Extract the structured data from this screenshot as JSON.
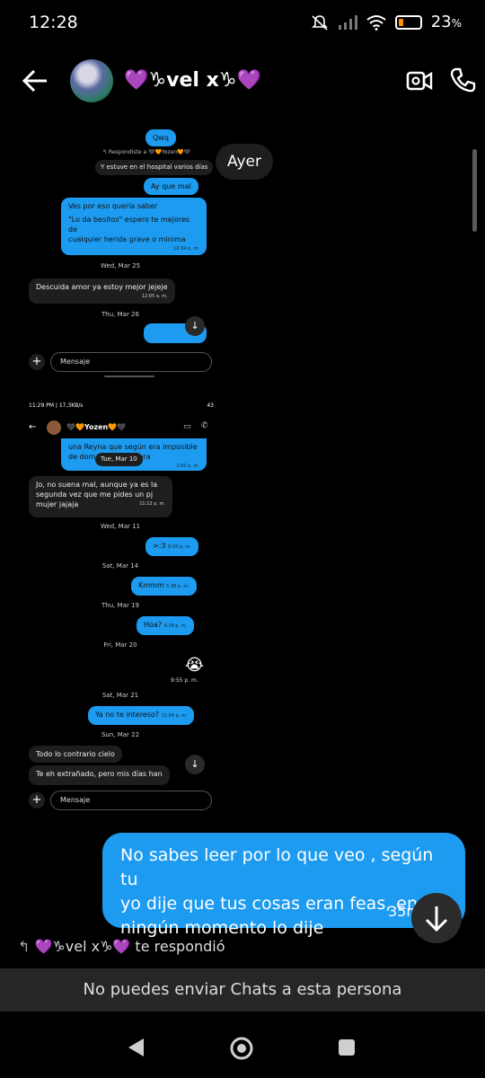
{
  "status": {
    "time": "12:28",
    "battery": "23",
    "battery_unit": "%",
    "battery_level": 0.23,
    "accent": "#ff9100"
  },
  "header": {
    "name": "💜♑vel x♑💜",
    "icons": [
      "back-arrow-icon",
      "video-call-icon",
      "phone-icon"
    ]
  },
  "shot1": {
    "m1": "Qwq",
    "reply_label": "↰ Respondiste a 🖤🧡Yozen🧡🖤",
    "quote": "Y estuve en el hospital varios días",
    "m2": "Ay que mal",
    "m3a": "Ves por eso quería saber",
    "m3b": "\"Lo da besitos\" espero te mejores de",
    "m3c": "cualquier herida grave o minima",
    "m3_time": "10:34 p. m.",
    "day1": "Wed, Mar 25",
    "m4": "Descuida amor ya estoy mejor jejeje",
    "m4_time": "12:05 a. m.",
    "day2": "Thu, Mar 26",
    "composer": "Mensaje"
  },
  "shot2": {
    "status_left": "11:29 PM | 17,3KB/s",
    "status_right": "43",
    "name": "🖤🧡Yozen🧡🖤",
    "top_a": "una Reyna que según era imposible",
    "top_b": "de dom              son mi ternura",
    "top_time": "1:50 p. m.",
    "sticky_day": "Tue, Mar 10",
    "m1a": "Jo, no suena mal, aunque ya es la",
    "m1b": "segunda vez que me pides un pj",
    "m1c": "mujer jajaja",
    "m1_time": "11:12 p. m.",
    "day1": "Wed, Mar 11",
    "m2": ">:3",
    "m2_time": "8:05 p. m.",
    "day2": "Sat, Mar 14",
    "m3": "Kmmm",
    "m3_time": "5:36 p. m.",
    "day3": "Thu, Mar 19",
    "m4": "Hoa?",
    "m4_time": "6:39 p. m.",
    "day4": "Fri, Mar 20",
    "emoji": "😭",
    "emoji_time": "9:55 p. m.",
    "day5": "Sat, Mar 21",
    "m5": "Ya no te intereso?",
    "m5_time": "12:04 p. m.",
    "day6": "Sun, Mar 22",
    "m6": "Todo lo contrario cielo",
    "m7": "Te eh extrañado, pero mis días han",
    "composer": "Mensaje"
  },
  "ayer": "Ayer",
  "big_message": {
    "line1": "No sabes leer por lo que veo , según tu",
    "line2": "yo dije que tus cosas eran feas, en",
    "line3": "ningún momento lo dije",
    "time": "35m"
  },
  "replied": "💜♑vel x♑💜 te respondió",
  "cant_send": "No puedes enviar Chats a esta persona",
  "colors": {
    "blue": "#1d9bf0",
    "dark": "#1e1e1e"
  }
}
